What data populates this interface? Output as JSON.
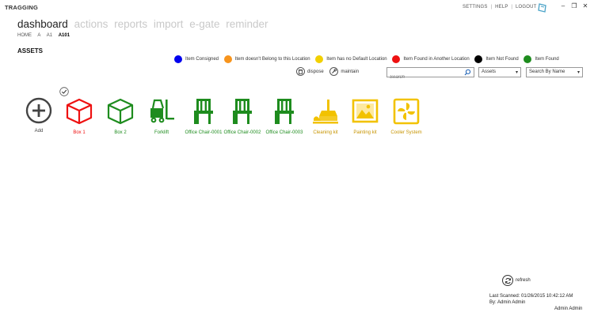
{
  "app": {
    "title": "TRAGGING"
  },
  "top_links": {
    "settings": "SETTINGS",
    "help": "HELP",
    "logout": "LOGOUT",
    "separator": "|"
  },
  "window_controls": {
    "minimize": "–",
    "restore": "❐",
    "close": "✕"
  },
  "nav": {
    "items": [
      "dashboard",
      "actions",
      "reports",
      "import",
      "e-gate",
      "reminder"
    ],
    "active_index": 0
  },
  "breadcrumb": [
    "HOME",
    "A",
    "A1",
    "A101"
  ],
  "section_title": "ASSETS",
  "legend": [
    {
      "label": "Item Consigned",
      "color": "#0000ee"
    },
    {
      "label": "Item doesn't Belong to this Location",
      "color": "#f7941d"
    },
    {
      "label": "Item has no Default Location",
      "color": "#f2d000"
    },
    {
      "label": "Item Found in Another Location",
      "color": "#ee1111"
    },
    {
      "label": "Item Not Found",
      "color": "#000000"
    },
    {
      "label": "Item Found",
      "color": "#1e8c1e"
    }
  ],
  "actions": {
    "dispose": "dispose",
    "maintain": "maintain"
  },
  "search": {
    "placeholder": "Search"
  },
  "filters": {
    "category": "Assets",
    "mode": "Search By Name"
  },
  "assets": [
    {
      "label": "Add",
      "icon": "add-icon",
      "color": "#444444"
    },
    {
      "label": "Box 1",
      "icon": "box-icon",
      "color": "#ee1111"
    },
    {
      "label": "Box 2",
      "icon": "box-icon",
      "color": "#1e8c1e"
    },
    {
      "label": "Forklift",
      "icon": "forklift-icon",
      "color": "#1e8c1e"
    },
    {
      "label": "Office Chair-0001",
      "icon": "chair-icon",
      "color": "#1e8c1e"
    },
    {
      "label": "Office Chair-0002",
      "icon": "chair-icon",
      "color": "#1e8c1e"
    },
    {
      "label": "Office Chair-0003",
      "icon": "chair-icon",
      "color": "#1e8c1e"
    },
    {
      "label": "Cleaning kit",
      "icon": "cleaning-kit-icon",
      "color": "#f2c200"
    },
    {
      "label": "Painting kit",
      "icon": "painting-kit-icon",
      "color": "#f2c200"
    },
    {
      "label": "Cooler System",
      "icon": "cooler-system-icon",
      "color": "#f2c200"
    }
  ],
  "footer": {
    "refresh": "refresh",
    "last_scanned": "Last Scanned: 01/26/2015 10:42:12 AM",
    "scanned_by": "By: Admin Admin",
    "user": "Admin Admin"
  }
}
